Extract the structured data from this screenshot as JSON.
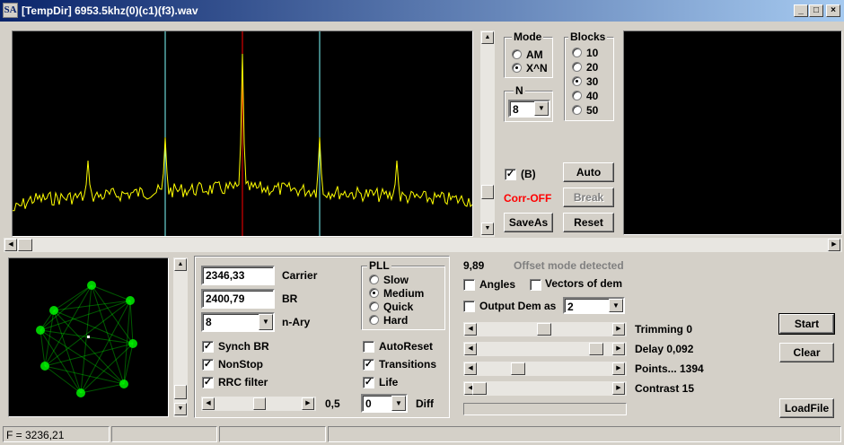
{
  "window": {
    "title": "[TempDir] 6953.5khz(0)(c1)(f3).wav",
    "icon_text": "SA",
    "min": "_",
    "max": "□",
    "close": "×"
  },
  "mode": {
    "title": "Mode",
    "options": [
      "AM",
      "X^N"
    ],
    "selected": 1
  },
  "blocks": {
    "title": "Blocks",
    "options": [
      "10",
      "20",
      "30",
      "40",
      "50"
    ],
    "selected": 2
  },
  "n": {
    "title": "N",
    "value": "8"
  },
  "controls": {
    "b_label": "(B)",
    "b_checked": true,
    "corr": "Corr-OFF",
    "auto": "Auto",
    "break": "Break",
    "saveas": "SaveAs",
    "reset": "Reset"
  },
  "params": {
    "carrier_value": "2346,33",
    "carrier_label": "Carrier",
    "br_value": "2400,79",
    "br_label": "BR",
    "nary_value": "8",
    "nary_label": "n-Ary",
    "checks_left": [
      {
        "label": "Synch BR",
        "checked": true
      },
      {
        "label": "NonStop",
        "checked": true
      },
      {
        "label": "RRC filter",
        "checked": true
      }
    ],
    "checks_right": [
      {
        "label": "AutoReset",
        "checked": false
      },
      {
        "label": "Transitions",
        "checked": true
      },
      {
        "label": "Life",
        "checked": true
      }
    ],
    "slider_value": "0,5",
    "diff_value": "0",
    "diff_label": "Diff"
  },
  "pll": {
    "title": "PLL",
    "options": [
      "Slow",
      "Medium",
      "Quick",
      "Hard"
    ],
    "selected": 1
  },
  "right": {
    "value": "9,89",
    "offset_msg": "Offset mode detected",
    "angles": "Angles",
    "vectors": "Vectors of dem",
    "output_dem": "Output Dem as",
    "output_value": "2",
    "sliders": [
      {
        "label": "Trimming 0"
      },
      {
        "label": "Delay  0,092"
      },
      {
        "label": "Points... 1394"
      },
      {
        "label": "Contrast 15"
      }
    ],
    "start": "Start",
    "clear": "Clear",
    "loadfile": "LoadFile"
  },
  "status": {
    "freq": "F = 3236,21"
  },
  "colors": {
    "spectrum": "#ffff00",
    "marker_center": "#ff0000",
    "marker_side": "#80ffff",
    "constellation": "#00ff00",
    "corr": "#ff0000"
  }
}
